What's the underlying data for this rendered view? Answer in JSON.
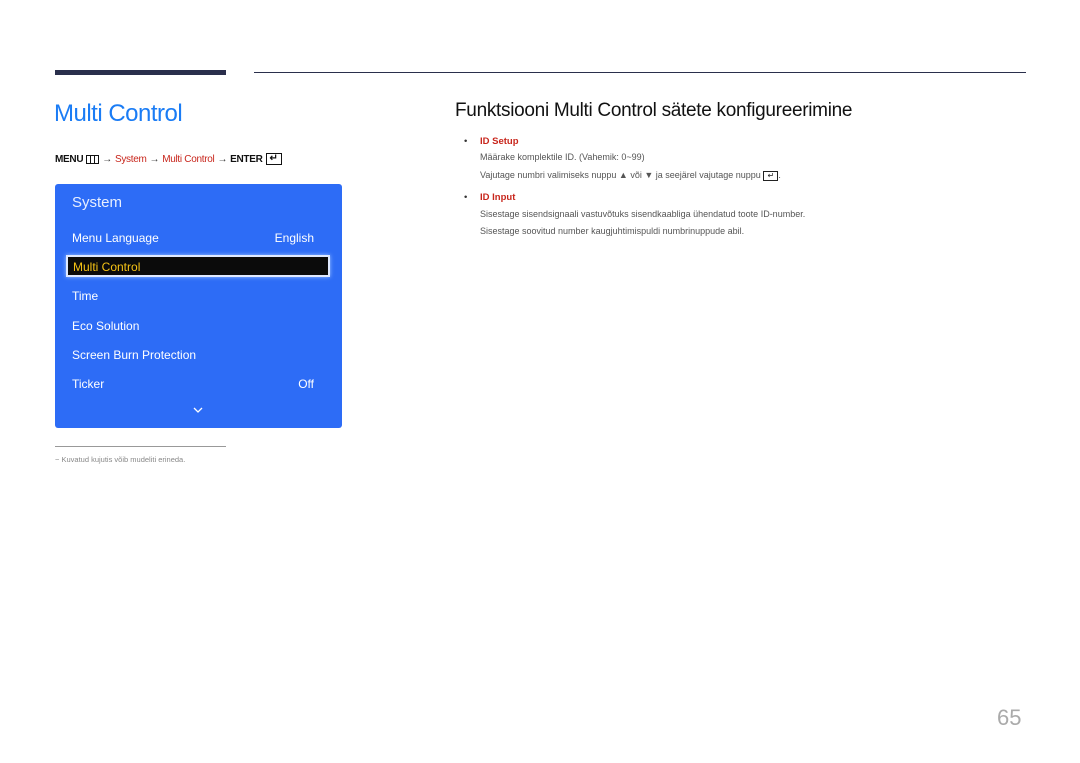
{
  "header": {
    "page_title": "Multi Control"
  },
  "breadcrumb": {
    "menu": "MENU",
    "menu_icon": "menu-grid-icon",
    "arrow": "→",
    "system": "System",
    "multi_control": "Multi Control",
    "enter": "ENTER",
    "enter_icon": "↵"
  },
  "osd": {
    "title": "System",
    "items": [
      {
        "label": "Menu Language",
        "value": "English"
      },
      {
        "label": "Multi Control",
        "value": ""
      },
      {
        "label": "Time",
        "value": ""
      },
      {
        "label": "Eco Solution",
        "value": ""
      },
      {
        "label": "Screen Burn Protection",
        "value": ""
      },
      {
        "label": "Ticker",
        "value": "Off"
      }
    ],
    "selected_index": 1,
    "colors": {
      "background": "#2d6cf6",
      "selected_text": "#f6c315"
    }
  },
  "footnote": {
    "dash": "−",
    "text": "Kuvatud kujutis võib mudeliti erineda."
  },
  "section": {
    "title": "Funktsiooni Multi Control sätete konfigureerimine",
    "bullets": [
      {
        "heading": "ID Setup",
        "lines": [
          "Määrake komplektile ID. (Vahemik: 0~99)",
          "Vajutage numbri valimiseks nuppu ▲ või ▼ ja seejärel vajutage nuppu"
        ],
        "enter_icon": "↵",
        "end": "."
      },
      {
        "heading": "ID Input",
        "lines": [
          "Sisestage sisendsignaali vastuvõtuks sisendkaabliga ühendatud toote ID-number.",
          "Sisestage soovitud number kaugjuhtimispuldi numbrinuppude abil."
        ]
      }
    ],
    "bullet_char": "•"
  },
  "page_number": "65"
}
